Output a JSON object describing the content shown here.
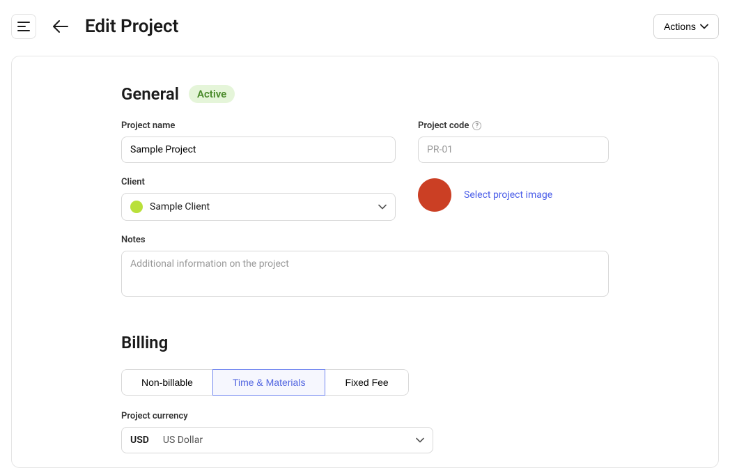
{
  "header": {
    "title": "Edit Project",
    "actions_label": "Actions"
  },
  "general": {
    "section_title": "General",
    "status_label": "Active",
    "project_name_label": "Project name",
    "project_name_value": "Sample Project",
    "project_code_label": "Project code",
    "project_code_placeholder": "PR-01",
    "client_label": "Client",
    "client_value": "Sample Client",
    "client_color": "#b9e03a",
    "image_button_label": "Select project image",
    "image_color": "#cb3f24",
    "notes_label": "Notes",
    "notes_placeholder": "Additional information on the project"
  },
  "billing": {
    "section_title": "Billing",
    "tabs": [
      {
        "label": "Non-billable",
        "active": false
      },
      {
        "label": "Time & Materials",
        "active": true
      },
      {
        "label": "Fixed Fee",
        "active": false
      }
    ],
    "currency_label": "Project currency",
    "currency_code": "USD",
    "currency_name": "US Dollar"
  }
}
